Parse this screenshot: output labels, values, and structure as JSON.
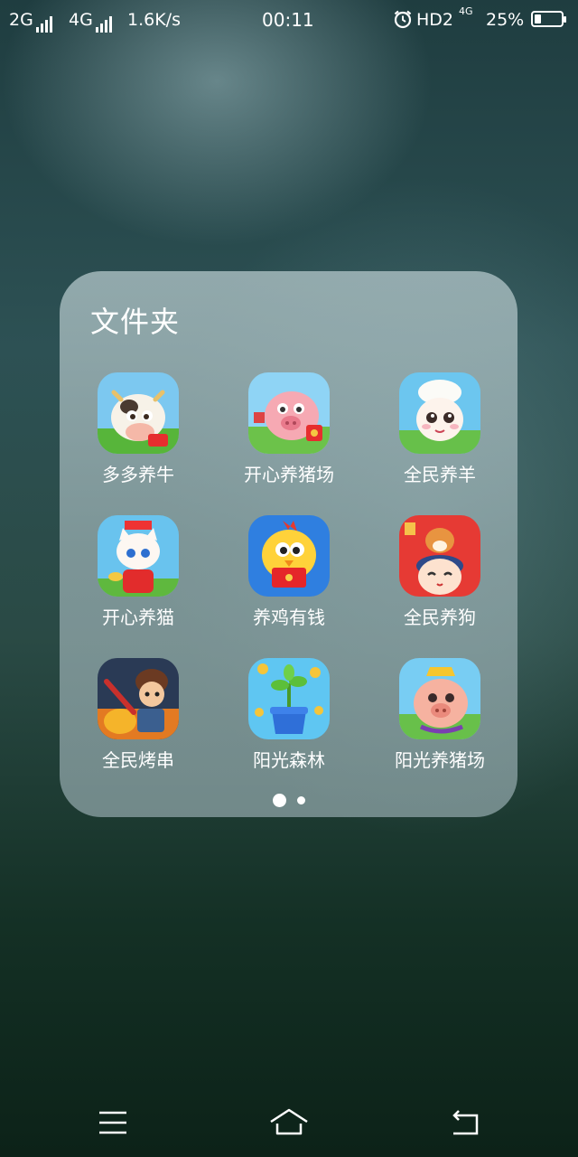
{
  "status_bar": {
    "network1": "2G",
    "network2": "4G",
    "speed": "1.6K/s",
    "time": "00:11",
    "alarm_icon": "alarm-clock-icon",
    "hd": "HD2",
    "network3": "4G",
    "battery_text": "25%",
    "battery_level": 0.25
  },
  "folder": {
    "title": "文件夹",
    "apps": [
      {
        "label": "多多养牛",
        "icon": "cow-game-icon"
      },
      {
        "label": "开心养猪场",
        "icon": "pig-farm-icon"
      },
      {
        "label": "全民养羊",
        "icon": "sheep-game-icon"
      },
      {
        "label": "开心养猫",
        "icon": "cat-game-icon"
      },
      {
        "label": "养鸡有钱",
        "icon": "chicken-game-icon"
      },
      {
        "label": "全民养狗",
        "icon": "dog-game-icon"
      },
      {
        "label": "全民烤串",
        "icon": "skewer-game-icon"
      },
      {
        "label": "阳光森林",
        "icon": "sapling-game-icon"
      },
      {
        "label": "阳光养猪场",
        "icon": "sunshine-pig-icon"
      }
    ],
    "pages": 2,
    "current_page": 1
  },
  "nav_bar": {
    "menu_icon": "menu-icon",
    "home_icon": "home-icon",
    "back_icon": "back-icon"
  }
}
